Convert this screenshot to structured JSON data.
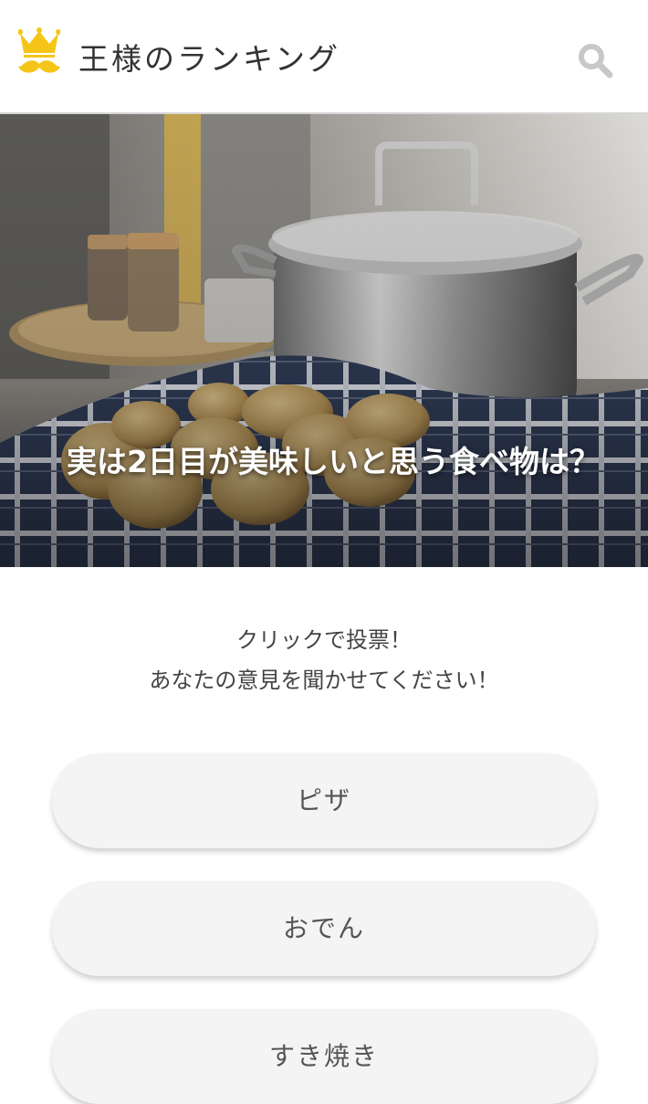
{
  "header": {
    "app_title": "王様のランキング",
    "logo_icon": "crown-mustache-icon",
    "search_icon": "search-icon"
  },
  "hero": {
    "image": "cooking-pot-and-potatoes-photo",
    "title": "実は2日目が美味しいと思う食べ物は？"
  },
  "intro": {
    "line1": "クリックで投票！",
    "line2": "あなたの意見を聞かせてください！"
  },
  "options": [
    {
      "label": "ピザ"
    },
    {
      "label": "おでん"
    },
    {
      "label": "すき焼き"
    }
  ],
  "colors": {
    "accent_gold": "#F5C518",
    "button_bg": "#F4F4F4",
    "text": "#333333"
  }
}
